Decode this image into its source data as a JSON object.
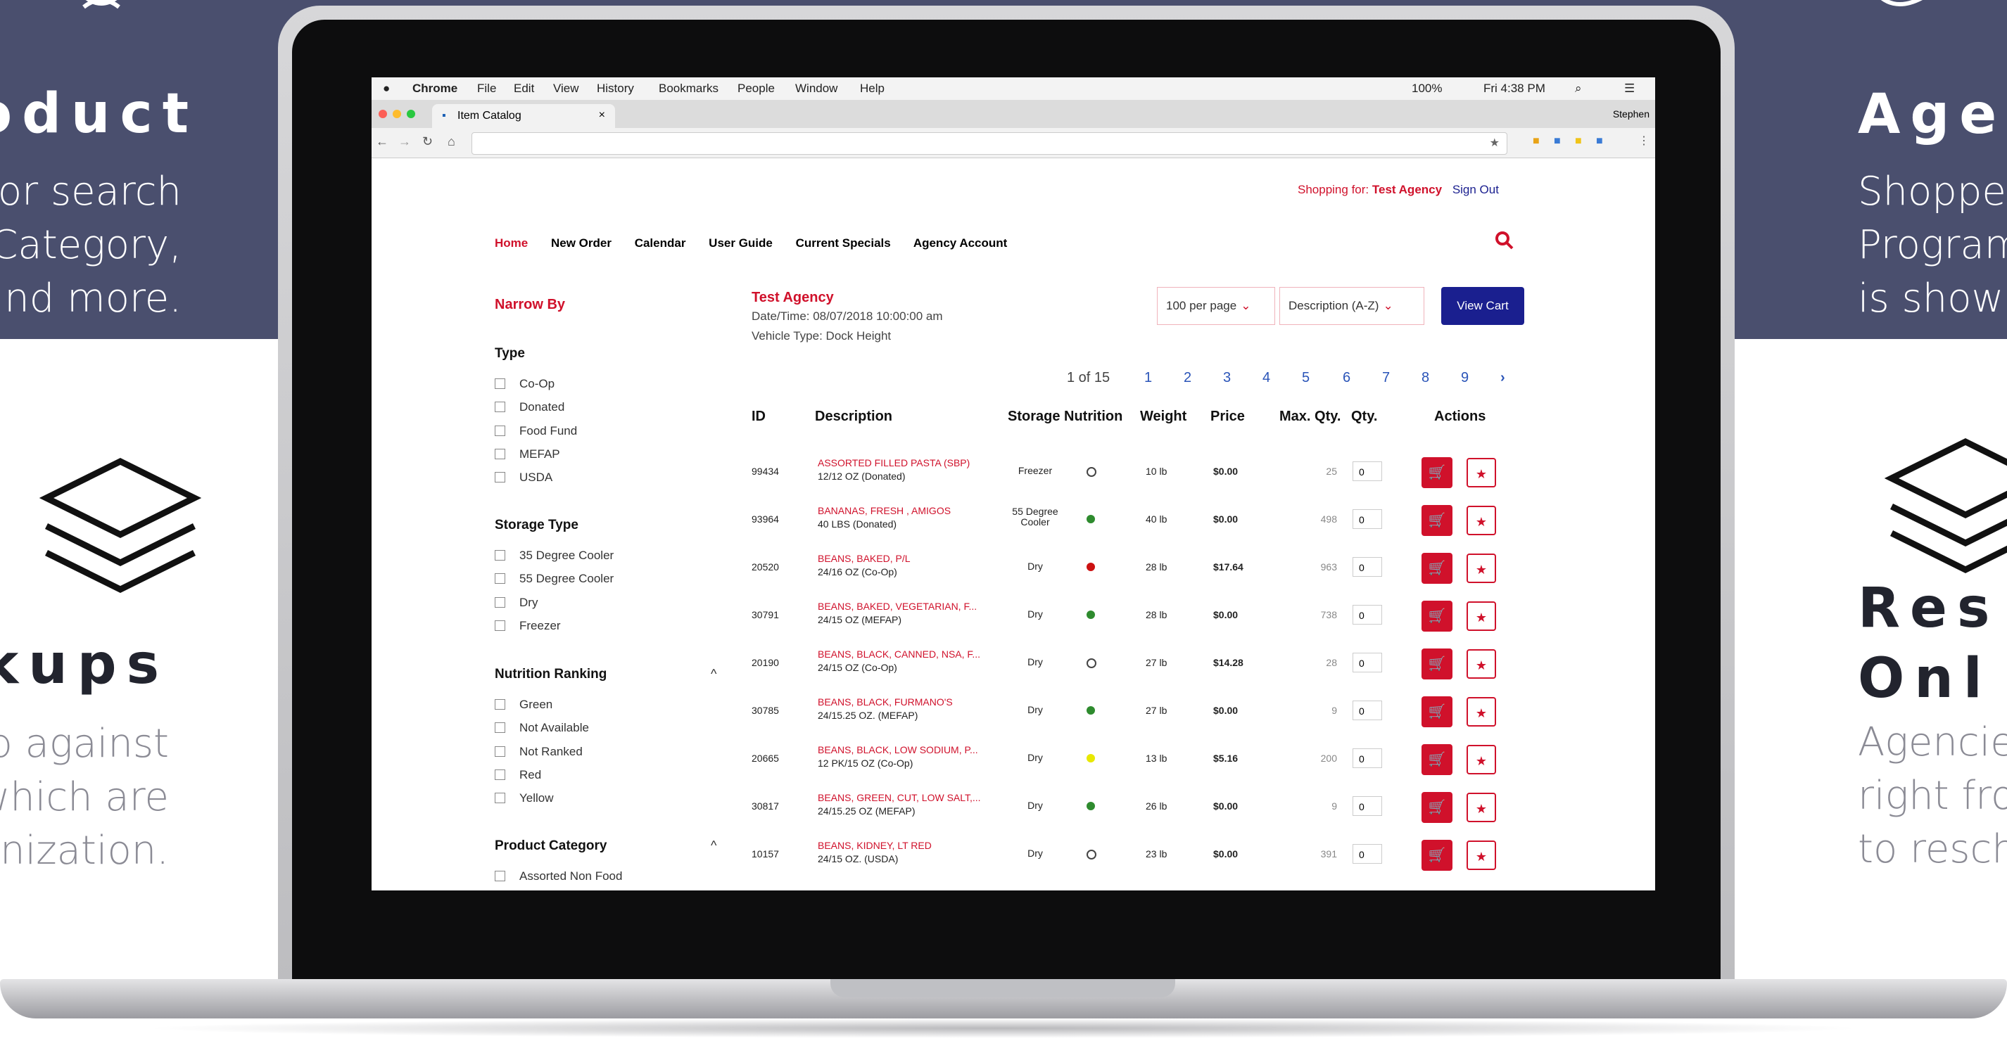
{
  "marketing": {
    "left": {
      "title1": "oduct",
      "text1": [
        "or search",
        "Category,",
        "and more."
      ],
      "title2": "kups",
      "text2": [
        "p against",
        "which are",
        "anization."
      ]
    },
    "right": {
      "title1": "Age",
      "text1": [
        "Shoppe",
        "Program",
        "is shown"
      ],
      "title2a": "Res",
      "title2b": "Onl",
      "text2": [
        "Agencie",
        "right fro",
        "to resch"
      ]
    }
  },
  "menubar": {
    "app": "Chrome",
    "items": [
      "File",
      "Edit",
      "View",
      "History",
      "Bookmarks",
      "People",
      "Window",
      "Help"
    ],
    "right_status": "100%",
    "clock": "Fri 4:38 PM"
  },
  "browser": {
    "tab_title": "Item Catalog",
    "tab_close": "×",
    "profile": "Stephen"
  },
  "site": {
    "shopping_for_label": "Shopping for:",
    "shopping_for_value": "Test Agency",
    "sign_out": "Sign Out",
    "nav": [
      "Home",
      "New Order",
      "Calendar",
      "User Guide",
      "Current Specials",
      "Agency Account"
    ],
    "agency_name": "Test Agency",
    "datetime": "Date/Time: 08/07/2018 10:00:00 am",
    "vehicle": "Vehicle Type: Dock Height",
    "per_page": "100 per page",
    "sort": "Description (A-Z)",
    "view_cart": "View Cart",
    "page_info": "1 of 15",
    "pages": [
      "1",
      "2",
      "3",
      "4",
      "5",
      "6",
      "7",
      "8",
      "9"
    ],
    "next": "›"
  },
  "filters": {
    "title": "Narrow By",
    "type_title": "Type",
    "type_options": [
      "Co-Op",
      "Donated",
      "Food Fund",
      "MEFAP",
      "USDA"
    ],
    "storage_title": "Storage Type",
    "storage_options": [
      "35 Degree Cooler",
      "55 Degree Cooler",
      "Dry",
      "Freezer"
    ],
    "nutrition_title": "Nutrition Ranking",
    "nutrition_options": [
      "Green",
      "Not Available",
      "Not Ranked",
      "Red",
      "Yellow"
    ],
    "category_title": "Product Category",
    "category_options": [
      "Assorted Non Food"
    ],
    "collapse": "^"
  },
  "table": {
    "headers": [
      "ID",
      "Description",
      "Storage",
      "Nutrition",
      "Weight",
      "Price",
      "Max. Qty.",
      "Qty.",
      "Actions"
    ],
    "rows": [
      {
        "id": "99434",
        "d1": "ASSORTED FILLED PASTA (SBP)",
        "d2": "12/12 OZ (Donated)",
        "storage": "Freezer",
        "nutrition": "none",
        "weight": "10 lb",
        "price": "$0.00",
        "max": "25",
        "qty": "0"
      },
      {
        "id": "93964",
        "d1": "BANANAS, FRESH , AMIGOS",
        "d2": "40 LBS (Donated)",
        "storage": "55 Degree Cooler",
        "nutrition": "green",
        "weight": "40 lb",
        "price": "$0.00",
        "max": "498",
        "qty": "0"
      },
      {
        "id": "20520",
        "d1": "BEANS, BAKED, P/L",
        "d2": "24/16 OZ (Co-Op)",
        "storage": "Dry",
        "nutrition": "red",
        "weight": "28 lb",
        "price": "$17.64",
        "max": "963",
        "qty": "0"
      },
      {
        "id": "30791",
        "d1": "BEANS, BAKED, VEGETARIAN, F...",
        "d2": "24/15 OZ (MEFAP)",
        "storage": "Dry",
        "nutrition": "green",
        "weight": "28 lb",
        "price": "$0.00",
        "max": "738",
        "qty": "0"
      },
      {
        "id": "20190",
        "d1": "BEANS, BLACK, CANNED, NSA, F...",
        "d2": "24/15 OZ (Co-Op)",
        "storage": "Dry",
        "nutrition": "none",
        "weight": "27 lb",
        "price": "$14.28",
        "max": "28",
        "qty": "0"
      },
      {
        "id": "30785",
        "d1": "BEANS, BLACK, FURMANO'S",
        "d2": "24/15.25 OZ. (MEFAP)",
        "storage": "Dry",
        "nutrition": "green",
        "weight": "27 lb",
        "price": "$0.00",
        "max": "9",
        "qty": "0"
      },
      {
        "id": "20665",
        "d1": "BEANS, BLACK, LOW SODIUM, P...",
        "d2": "12 PK/15 OZ (Co-Op)",
        "storage": "Dry",
        "nutrition": "yellow",
        "weight": "13 lb",
        "price": "$5.16",
        "max": "200",
        "qty": "0"
      },
      {
        "id": "30817",
        "d1": "BEANS, GREEN, CUT, LOW SALT,...",
        "d2": "24/15.25 OZ (MEFAP)",
        "storage": "Dry",
        "nutrition": "green",
        "weight": "26 lb",
        "price": "$0.00",
        "max": "9",
        "qty": "0"
      },
      {
        "id": "10157",
        "d1": "BEANS, KIDNEY, LT RED",
        "d2": "24/15 OZ. (USDA)",
        "storage": "Dry",
        "nutrition": "none",
        "weight": "23 lb",
        "price": "$0.00",
        "max": "391",
        "qty": "0"
      }
    ]
  },
  "colors": {
    "brand_red": "#d0112b",
    "navy": "#1a1f8f",
    "band": "#4a4f6e"
  }
}
